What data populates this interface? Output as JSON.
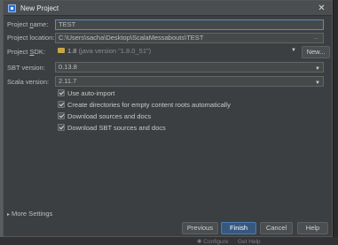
{
  "window": {
    "title": "New Project",
    "close_glyph": "✕"
  },
  "form": {
    "project_name": {
      "label_pre": "Project ",
      "label_u": "n",
      "label_post": "ame:",
      "value": "TEST"
    },
    "project_location": {
      "label": "Project location:",
      "value": "C:\\Users\\sacha\\Desktop\\ScalaMessabouts\\TEST",
      "browse": "..."
    },
    "project_sdk": {
      "label_pre": "Project ",
      "label_u": "S",
      "label_post": "DK:",
      "version": "1.8",
      "detail": "(java version \"1.8.0_51\")",
      "new_button": "New..."
    },
    "sbt_version": {
      "label": "SBT version:",
      "value": "0.13.8"
    },
    "scala_version": {
      "label": "Scala version:",
      "value": "2.11.7"
    }
  },
  "options": [
    {
      "label": "Use auto-import",
      "checked": true
    },
    {
      "label": "Create directories for empty content roots automatically",
      "checked": true
    },
    {
      "label": "Download sources and docs",
      "checked": true
    },
    {
      "label": "Download SBT sources and docs",
      "checked": true
    }
  ],
  "more_settings": {
    "glyph": "▸",
    "label": "More Settings"
  },
  "buttons": {
    "previous": "Previous",
    "finish": "Finish",
    "cancel": "Cancel",
    "help": "Help"
  },
  "background": {
    "configure": "✱ Configure",
    "get_help": "Get Help"
  },
  "colors": {
    "dialog_bg": "#3c3f41",
    "field_bg": "#45494a",
    "primary_button": "#365880"
  },
  "icons": [
    "app-icon",
    "close-icon",
    "folder-icon",
    "dropdown-arrow-icon",
    "checkbox-checked-icon",
    "expand-triangle-icon"
  ]
}
